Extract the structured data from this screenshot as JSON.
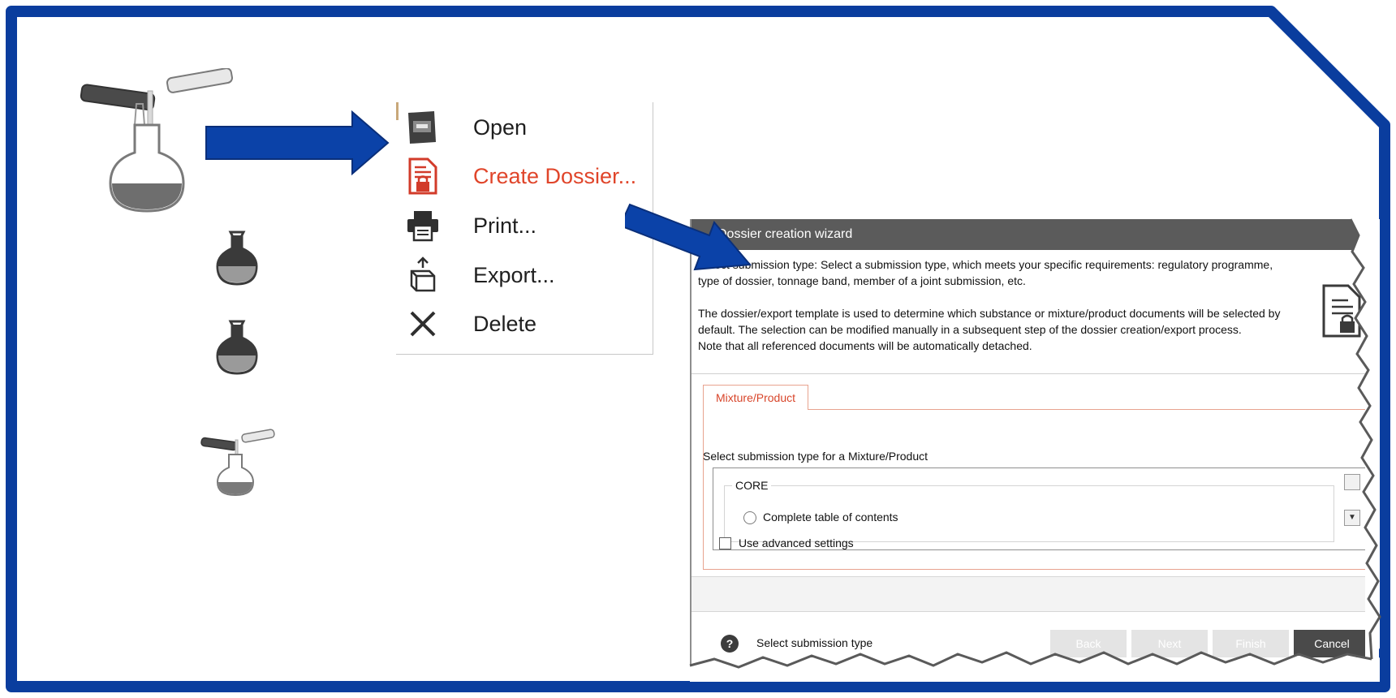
{
  "colors": {
    "frame_blue": "#0a3d9e",
    "arrow_blue": "#0b42a8",
    "accent_red": "#e0452a",
    "wizard_title_bg": "#5b5b5b"
  },
  "context_menu": {
    "items": [
      {
        "label": "Open",
        "icon": "open-window-icon"
      },
      {
        "label": "Create Dossier...",
        "icon": "dossier-lock-icon"
      },
      {
        "label": "Print...",
        "icon": "printer-icon"
      },
      {
        "label": "Export...",
        "icon": "export-box-icon"
      },
      {
        "label": "Delete",
        "icon": "delete-x-icon"
      }
    ]
  },
  "wizard": {
    "title": "Dossier creation wizard",
    "description": [
      "Select submission type: Select a submission type, which meets your specific requirements: regulatory programme, type of dossier, tonnage band, member of a joint submission, etc.",
      "The dossier/export template is used to determine which substance or mixture/product documents will be selected by default. The selection can be modified manually in a subsequent step of the dossier creation/export process.",
      "Note that all referenced documents will be automatically detached."
    ],
    "tab_label": "Mixture/Product",
    "panel_label": "Select submission type for a Mixture/Product",
    "group_label": "CORE",
    "option_label": "Complete table of contents",
    "checkbox_label": "Use advanced settings",
    "status_text": "Select submission type",
    "buttons": {
      "back": "Back",
      "next": "Next",
      "finish": "Finish",
      "cancel": "Cancel"
    }
  }
}
